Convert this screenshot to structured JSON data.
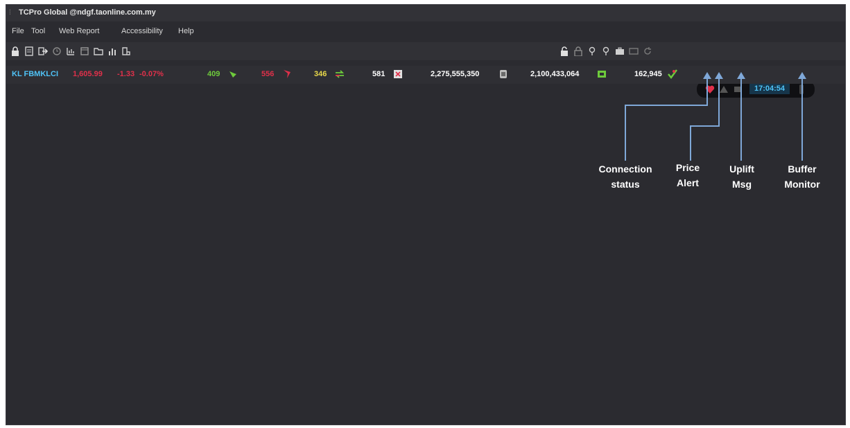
{
  "window": {
    "title": "TCPro Global @ndgf.taonline.com.my"
  },
  "menu": {
    "file": "File",
    "tool": "Tool",
    "web_report": "Web Report",
    "accessibility": "Accessibility",
    "help": "Help"
  },
  "toolbar_left": [
    "lock-icon",
    "document-icon",
    "logout-icon",
    "watch-icon",
    "chart-icon",
    "window-icon",
    "folder-icon",
    "bar-chart-icon",
    "report-icon"
  ],
  "toolbar_right": [
    "unlock-icon",
    "lock-icon",
    "pin-icon",
    "pin-icon",
    "briefcase-icon",
    "card-icon",
    "refresh-icon"
  ],
  "status": {
    "time": "17:04:54"
  },
  "ticker": {
    "index_name": "KL FBMKLCI",
    "index_value": "1,605.99",
    "index_change": "-1.33",
    "index_pct": "-0.07%",
    "up": "409",
    "down": "556",
    "unchanged": "346",
    "untraded": "581",
    "volume": "2,275,555,350",
    "value": "2,100,433,064",
    "trades": "162,945"
  },
  "annotations": {
    "connection_l1": "Connection",
    "connection_l2": "status",
    "price_l1": "Price",
    "price_l2": "Alert",
    "uplift_l1": "Uplift",
    "uplift_l2": "Msg",
    "buffer_l1": "Buffer",
    "buffer_l2": "Monitor"
  },
  "colors": {
    "background": "#2b2b30",
    "accent_blue": "#4fc3f7",
    "down_red": "#e0304a",
    "up_green": "#6ecb3c",
    "annotation_line": "#7fa8d8"
  }
}
